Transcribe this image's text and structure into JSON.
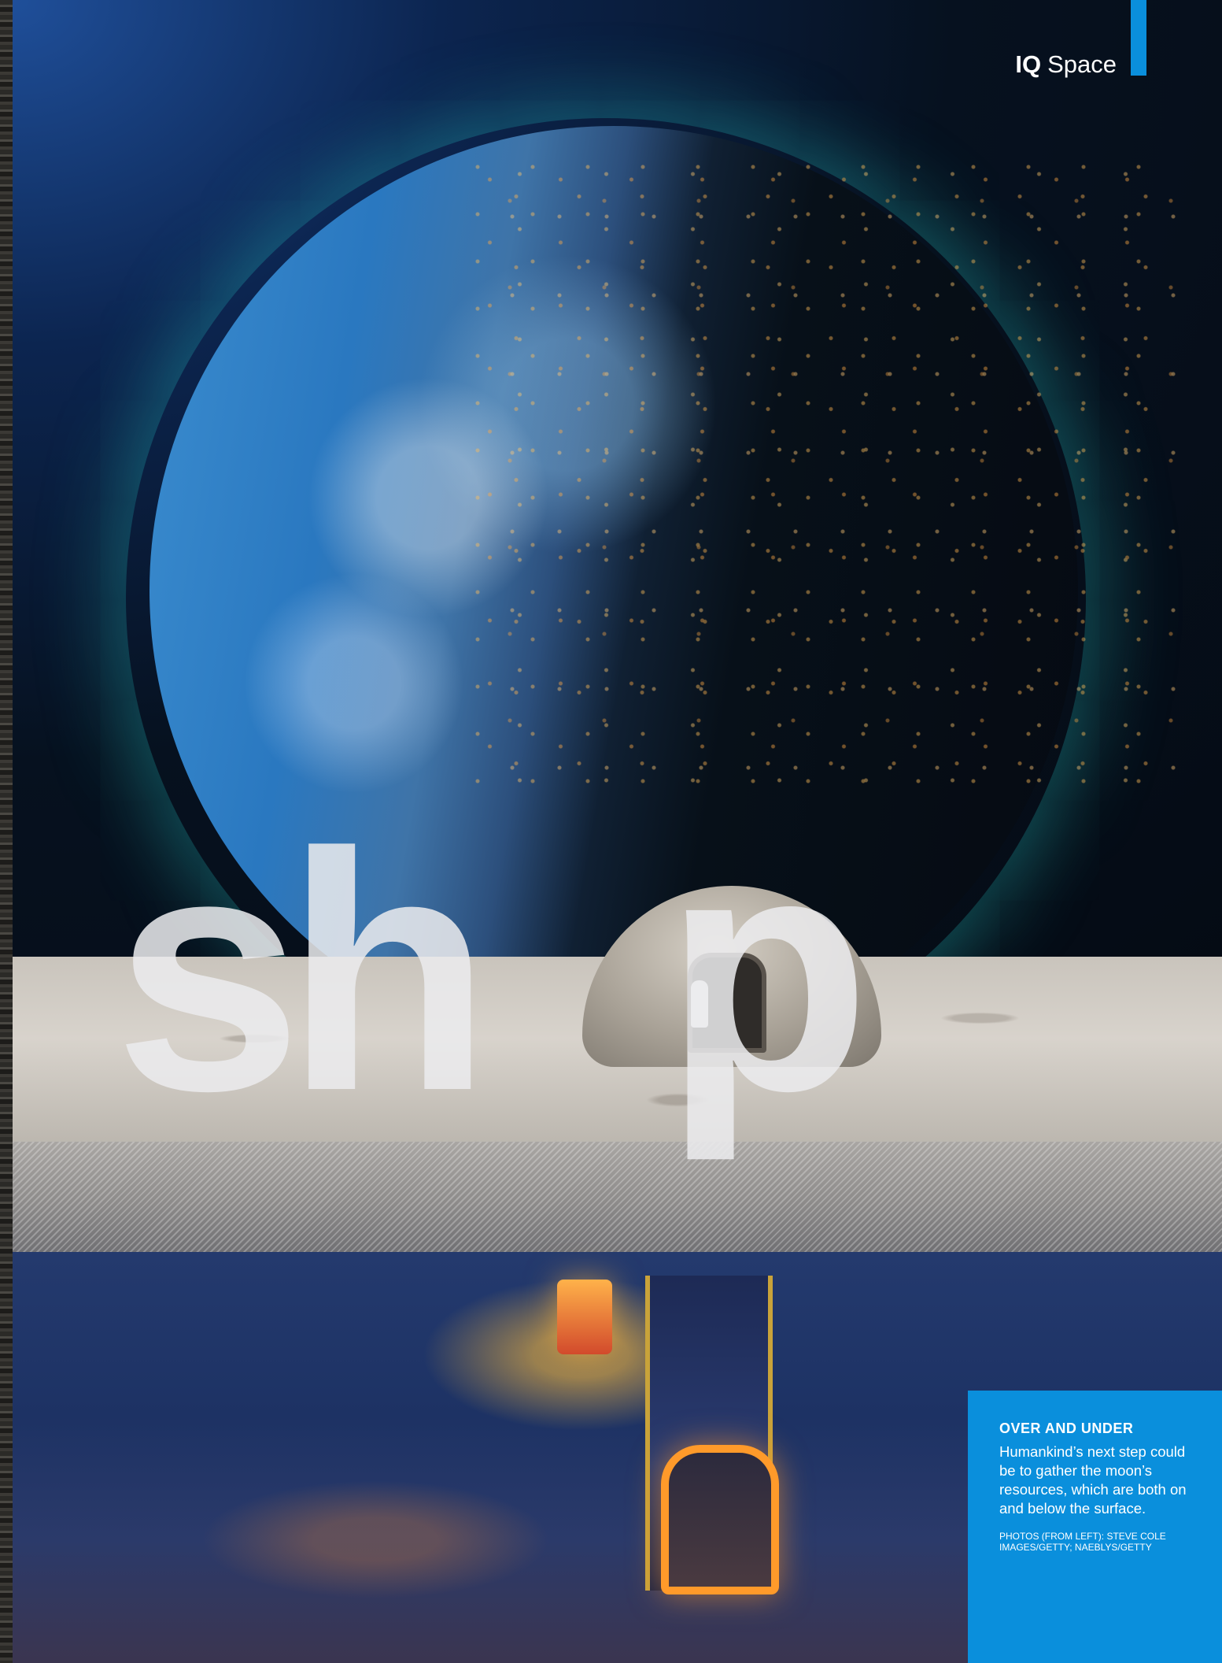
{
  "header": {
    "section_prefix": "IQ",
    "section_name": "Space"
  },
  "headline": {
    "letters": [
      "s",
      "h",
      "o",
      "p"
    ]
  },
  "caption": {
    "heading": "OVER AND UNDER",
    "body": "Humankind’s next step could be to gather the moon’s resources, which are both on and below the surface.",
    "credit": "PHOTOS (FROM LEFT): STEVE COLE IMAGES/GETTY; NAEBLYS/GETTY"
  },
  "colors": {
    "accent_blue": "#0a8fdc",
    "headline_text": "#ebebee",
    "background": "#07101a"
  },
  "illustration": {
    "subject_icons": [
      "earth-icon",
      "moon-surface-icon",
      "dome-habitat-icon",
      "astronaut-icon",
      "mine-shaft-icon"
    ]
  }
}
